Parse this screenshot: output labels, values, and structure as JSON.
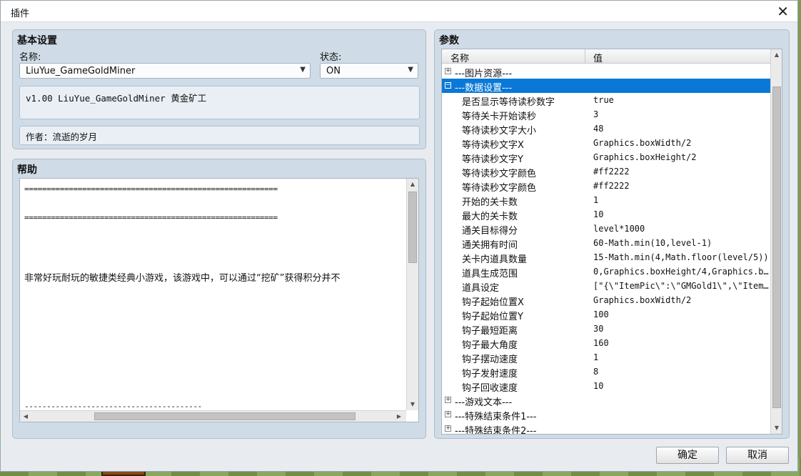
{
  "window": {
    "title": "插件",
    "close_glyph": "✕"
  },
  "basic": {
    "heading": "基本设置",
    "name_label": "名称:",
    "name_value": "LiuYue_GameGoldMiner",
    "status_label": "状态:",
    "status_value": "ON",
    "description": "v1.00 LiuYue_GameGoldMiner 黄金矿工",
    "author": "作者：流逝的岁月"
  },
  "help": {
    "heading": "帮助",
    "lines": [
      "=========================================================",
      "=========================================================",
      "非常好玩耐玩的敏捷类经典小游戏，该游戏中，可以通过“挖矿”获得积分并不",
      "----------------------------------------"
    ]
  },
  "params": {
    "heading": "参数",
    "col_name": "名称",
    "col_value": "值",
    "rows": [
      {
        "type": "cat",
        "expand": "+",
        "name": "---图片资源---",
        "value": ""
      },
      {
        "type": "cat",
        "expand": "−",
        "name": "---数据设置---",
        "value": "",
        "selected": true
      },
      {
        "type": "item",
        "name": "是否显示等待读秒数字",
        "value": "true"
      },
      {
        "type": "item",
        "name": "等待关卡开始读秒",
        "value": "3"
      },
      {
        "type": "item",
        "name": "等待读秒文字大小",
        "value": "48"
      },
      {
        "type": "item",
        "name": "等待读秒文字X",
        "value": "Graphics.boxWidth/2"
      },
      {
        "type": "item",
        "name": "等待读秒文字Y",
        "value": "Graphics.boxHeight/2"
      },
      {
        "type": "item",
        "name": "等待读秒文字颜色",
        "value": "#ff2222"
      },
      {
        "type": "item",
        "name": "等待读秒文字颜色",
        "value": "#ff2222"
      },
      {
        "type": "item",
        "name": "开始的关卡数",
        "value": "1"
      },
      {
        "type": "item",
        "name": "最大的关卡数",
        "value": "10"
      },
      {
        "type": "item",
        "name": "通关目标得分",
        "value": "level*1000"
      },
      {
        "type": "item",
        "name": "通关拥有时间",
        "value": "60-Math.min(10,level-1)"
      },
      {
        "type": "item",
        "name": "关卡内道具数量",
        "value": "15-Math.min(4,Math.floor(level/5))"
      },
      {
        "type": "item",
        "name": "道具生成范围",
        "value": "0,Graphics.boxHeight/4,Graphics.bo…"
      },
      {
        "type": "item",
        "name": "道具设定",
        "value": "[\"{\\\"ItemPic\\\":\\\"GMGold1\\\",\\\"ItemS…"
      },
      {
        "type": "item",
        "name": "钩子起始位置X",
        "value": "Graphics.boxWidth/2"
      },
      {
        "type": "item",
        "name": "钩子起始位置Y",
        "value": "100"
      },
      {
        "type": "item",
        "name": "钩子最短距离",
        "value": "30"
      },
      {
        "type": "item",
        "name": "钩子最大角度",
        "value": "160"
      },
      {
        "type": "item",
        "name": "钩子摆动速度",
        "value": "1"
      },
      {
        "type": "item",
        "name": "钩子发射速度",
        "value": "8"
      },
      {
        "type": "item",
        "name": "钩子回收速度",
        "value": "10"
      },
      {
        "type": "cat",
        "expand": "+",
        "name": "---游戏文本---",
        "value": ""
      },
      {
        "type": "cat",
        "expand": "+",
        "name": "---特殊结束条件1---",
        "value": ""
      },
      {
        "type": "cat",
        "expand": "+",
        "name": "---特殊结束条件2---",
        "value": ""
      }
    ]
  },
  "buttons": {
    "ok": "确定",
    "cancel": "取消"
  },
  "icons": {
    "dropdown": "chevron-down-icon",
    "scroll_up": "arrow-up-icon",
    "scroll_down": "arrow-down-icon",
    "scroll_left": "arrow-left-icon",
    "scroll_right": "arrow-right-icon",
    "expand": "plus-box-icon",
    "collapse": "minus-box-icon"
  },
  "colors": {
    "selection": "#0a78d7",
    "panel": "#cfdbe6",
    "dialog": "#e8ecf0"
  }
}
